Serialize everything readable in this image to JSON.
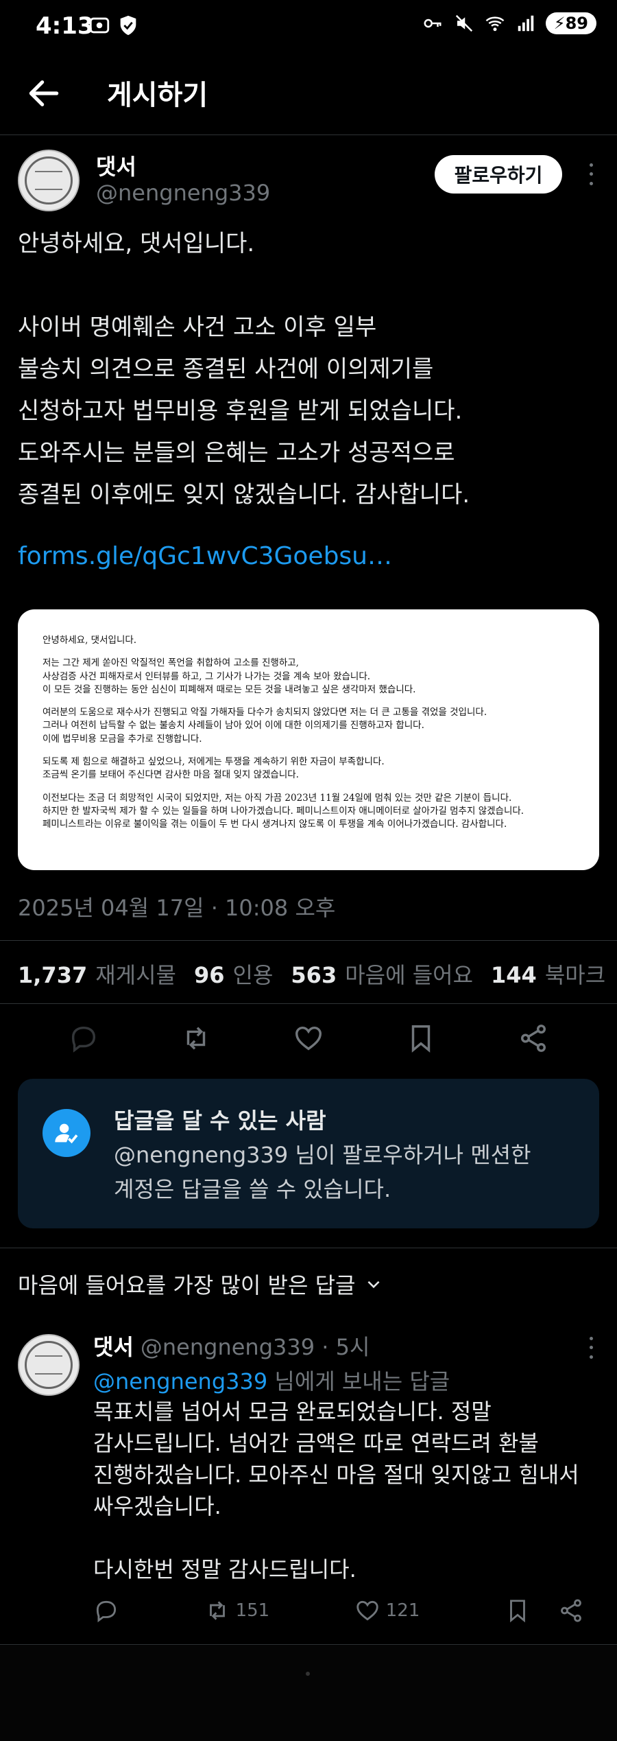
{
  "status_bar": {
    "time": "4:13",
    "battery": "89"
  },
  "header": {
    "title": "게시하기"
  },
  "post": {
    "author": {
      "name": "댓서",
      "handle": "@nengneng339"
    },
    "follow_label": "팔로우하기",
    "text_lines": [
      "안녕하세요, 댓서입니다.",
      "",
      "사이버 명예훼손 사건 고소 이후 일부",
      "불송치 의견으로 종결된 사건에 이의제기를",
      "신청하고자 법무비용 후원을 받게 되었습니다.",
      "도와주시는 분들의 은혜는 고소가 성공적으로",
      "종결된 이후에도 잊지 않겠습니다. 감사합니다."
    ],
    "link": "forms.gle/qGc1wvC3Goebsu…",
    "image_text": {
      "p1": [
        "안녕하세요, 댓서입니다."
      ],
      "p2": [
        "저는 그간 제게 쏟아진 악질적인 폭언을 취합하여 고소를 진행하고,",
        "사상검증 사건 피해자로서 인터뷰를 하고, 그 기사가 나가는 것을 계속 보아 왔습니다.",
        "이 모든 것을 진행하는 동안 심신이 피폐해져 때로는 모든 것을 내려놓고 싶은 생각마저 했습니다."
      ],
      "p3": [
        "여러분의 도움으로 재수사가 진행되고 악질 가해자들 다수가 송치되지 않았다면 저는 더 큰 고통을 겪었을 것입니다.",
        "그러나 여전히 납득할 수 없는 불송치 사례들이 남아 있어 이에 대한 이의제기를 진행하고자 합니다.",
        "이에 법무비용 모금을 추가로 진행합니다."
      ],
      "p4": [
        "되도록 제 힘으로 해결하고 싶었으나, 저에게는 투쟁을 계속하기 위한 자금이 부족합니다.",
        "조금씩 온기를 보태어 주신다면 감사한 마음 절대 잊지 않겠습니다."
      ],
      "p5": [
        "이전보다는 조금 더 희망적인 시국이 되었지만, 저는 아직 가끔 2023년 11월 24일에 멈춰 있는 것만 같은 기분이 듭니다.",
        "하지만 한 발자국씩 제가 할 수 있는 일들을 하며 나아가겠습니다. 페미니스트이자 애니메이터로 살아가길 멈추지 않겠습니다.",
        "페미니스트라는 이유로 불이익을 겪는 이들이 두 번 다시 생겨나지 않도록 이 투쟁을 계속 이어나가겠습니다. 감사합니다."
      ]
    },
    "timestamp": "2025년 04월 17일 · 10:08 오후",
    "stats": {
      "reposts_count": "1,737",
      "reposts_label": "재게시물",
      "quotes_count": "96",
      "quotes_label": "인용",
      "likes_count": "563",
      "likes_label": "마음에 들어요",
      "bookmarks_count": "144",
      "bookmarks_label": "북마크"
    }
  },
  "reply_restriction": {
    "title": "답글을 달 수 있는 사람",
    "body_line1": "@nengneng339 님이 팔로우하거나 멘션한",
    "body_line2": "계정은 답글을 쓸 수 있습니다."
  },
  "sort": {
    "label": "마음에 들어요를 가장 많이 받은 답글"
  },
  "reply": {
    "name": "댓서",
    "handle_time": "@nengneng339 · 5시",
    "mention": "@nengneng339",
    "reply_to_suffix": " 님에게 보내는 답글",
    "text_lines": [
      "목표치를 넘어서 모금 완료되었습니다. 정말",
      "감사드립니다. 넘어간 금액은 따로 연락드려 환불",
      "진행하겠습니다. 모아주신 마음 절대 잊지않고 힘내서",
      "싸우겠습니다.",
      "",
      "다시한번 정말 감사드립니다."
    ],
    "repost_count": "151",
    "like_count": "121"
  },
  "colors": {
    "background": "#000000",
    "accent": "#1d9bf0",
    "muted": "#71767b"
  }
}
